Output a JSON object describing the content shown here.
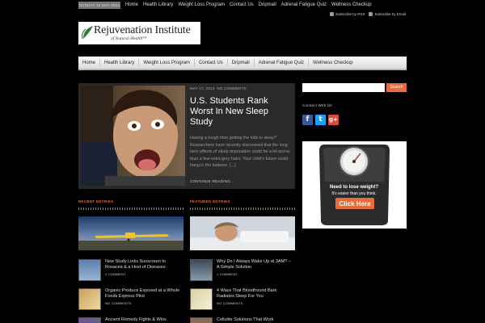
{
  "topbar": {
    "date": "SUNDAY 15 MAY 2016",
    "links": [
      "Home",
      "Health Library",
      "Weight Loss Program",
      "Contact Us",
      "Dripmail",
      "Adrenal Fatigue Quiz",
      "Wellness Checkup"
    ]
  },
  "feeds": [
    "Subscribe by RSS",
    "Subscribe by Email"
  ],
  "logo": {
    "title": "Rejuvenation Institute",
    "subtitle": "of Natural Health™"
  },
  "nav": [
    "Home",
    "Health Library",
    "Weight Loss Program",
    "Contact Us",
    "Dripmail",
    "Adrenal Fatigue Quiz",
    "Wellness Checkup"
  ],
  "featured": {
    "date": "MAY 17, 2013",
    "comments": "NO COMMENTS",
    "title": "U.S. Students Rank Worst In New Sleep Study",
    "excerpt": "Having a tough time getting the kids to sleep? Researchers have recently discovered that the long term effects of sleep deprivation could be a lot worse than a few extra grey hairs. Your child's future could hang in the balance. [...]",
    "continue": "CONTINUE READING..."
  },
  "recent": {
    "heading": "RECENT ENTRIES",
    "items": [
      {
        "title": "New Study Links Sunscreen to Rosacea & a Host of Diseases",
        "comments": "1 COMMENT"
      },
      {
        "title": "Organic Produce Exposed at a Whole Foods Express Pilot",
        "comments": "NO COMMENTS"
      },
      {
        "title": "Ancient Remedy Fights & Wins",
        "comments": ""
      }
    ]
  },
  "featuredPosts": {
    "heading": "FEATURED ENTRIES",
    "items": [
      {
        "title": "Why Do I Always Wake Up at 3AM? – A Simple Solution",
        "comments": "1 COMMENT"
      },
      {
        "title": "4 Ways That Bloodhound Bark Radiates Sleep For You",
        "comments": "NO COMMENTS"
      },
      {
        "title": "Cellulite Solutions That Work",
        "comments": ""
      }
    ]
  },
  "sidebar": {
    "search_button": "Search",
    "connect": "Connect With Us",
    "ad_line1": "Need to lose weight?",
    "ad_line2": "It's easier than you think.",
    "ad_button": "Click Here"
  },
  "colors": {
    "accent": "#e96a3a",
    "facebook": "#3b5998",
    "twitter": "#1da1f2",
    "google": "#dd4b39"
  }
}
